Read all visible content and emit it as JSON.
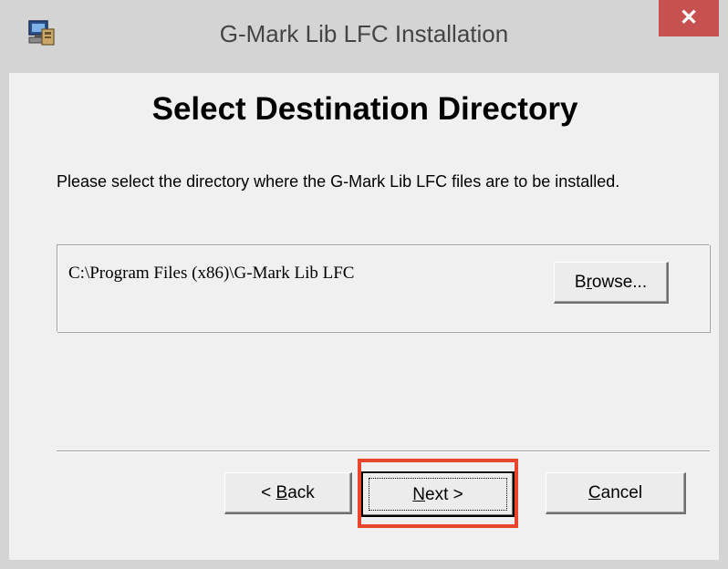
{
  "window": {
    "title": "G-Mark Lib LFC Installation",
    "close_label": "✕"
  },
  "icons": {
    "app": "installer-computer-icon",
    "close": "close-icon"
  },
  "page": {
    "heading": "Select Destination Directory",
    "instructions": "Please select the directory where the G-Mark Lib LFC files are to be installed.",
    "destination_path": "C:\\Program Files (x86)\\G-Mark Lib LFC"
  },
  "buttons": {
    "browse": {
      "pre": "B",
      "mnemonic": "r",
      "post": "owse..."
    },
    "back": {
      "pre": "< ",
      "mnemonic": "B",
      "post": "ack"
    },
    "next": {
      "pre": "",
      "mnemonic": "N",
      "post": "ext >"
    },
    "cancel": {
      "pre": "",
      "mnemonic": "C",
      "post": "ancel"
    }
  },
  "colors": {
    "close_button": "#c75050",
    "highlight": "#e8452c",
    "chrome": "#d4d4d4",
    "dialog_bg": "#f0f0f0"
  }
}
